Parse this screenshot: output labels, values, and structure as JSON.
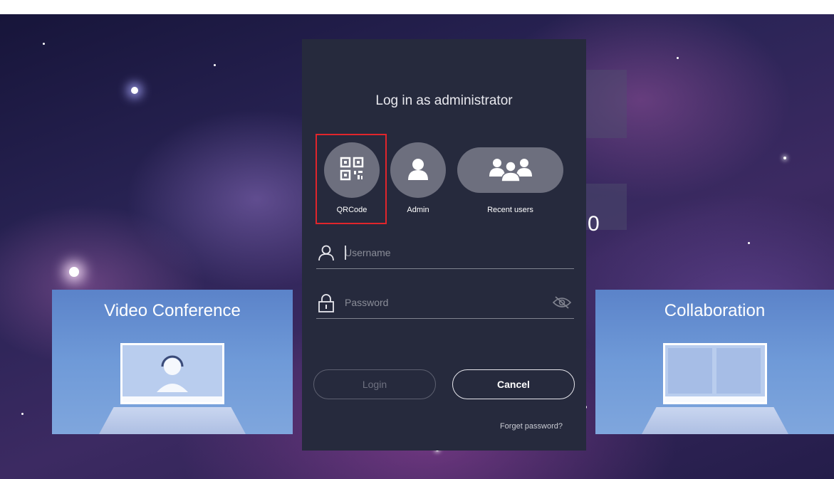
{
  "dialog": {
    "title": "Log in as administrator",
    "options": [
      {
        "label": "QRCode",
        "icon": "qrcode-icon",
        "highlighted": true
      },
      {
        "label": "Admin",
        "icon": "user-icon",
        "highlighted": false
      },
      {
        "label": "Recent users",
        "icon": "users-group-icon",
        "highlighted": false
      }
    ],
    "username": {
      "value": "",
      "placeholder": "Username"
    },
    "password": {
      "value": "",
      "placeholder": "Password"
    },
    "login_label": "Login",
    "cancel_label": "Cancel",
    "forget_label": "Forget password?"
  },
  "background": {
    "tiles": [
      {
        "label": "Video Conference"
      },
      {
        "label": "Collaboration"
      }
    ],
    "partial_digit": "0"
  },
  "colors": {
    "dialog_bg": "#262a3d",
    "option_circle": "#6d6f7e",
    "highlight": "#e0252b",
    "tile": "#6f9ad8"
  }
}
